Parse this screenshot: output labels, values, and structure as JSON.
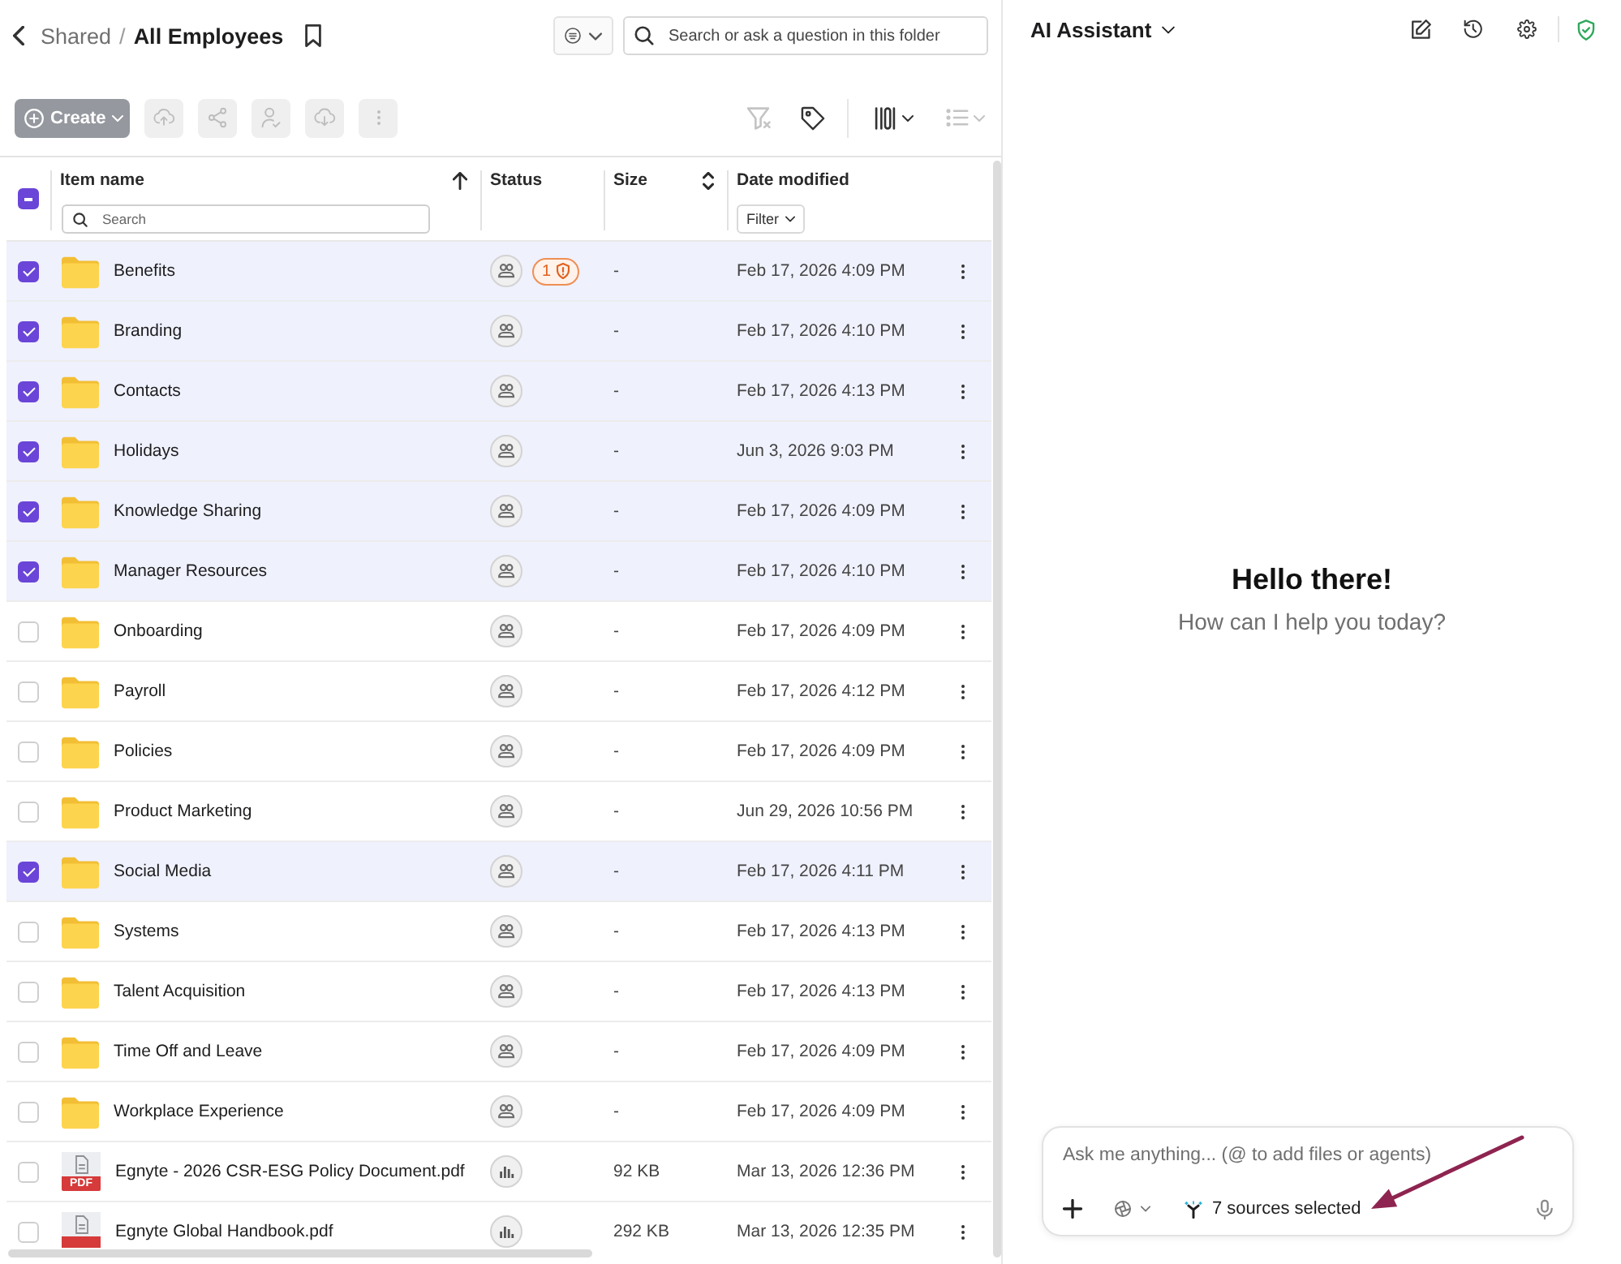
{
  "breadcrumb": {
    "items": [
      {
        "label": "Shared",
        "current": false
      },
      {
        "label": "All Employees",
        "current": true
      }
    ],
    "separator": "/",
    "bookmarked": false
  },
  "search": {
    "placeholder": "Search or ask a question in this folder"
  },
  "toolbar": {
    "create": {
      "label": "Create",
      "disabled": true
    },
    "actions": [
      {
        "kind": "upload",
        "disabled": true
      },
      {
        "kind": "share",
        "disabled": true
      },
      {
        "kind": "assign",
        "disabled": true
      },
      {
        "kind": "download",
        "disabled": true
      },
      {
        "kind": "more",
        "disabled": true
      }
    ],
    "view_tools": [
      {
        "kind": "clear_filter",
        "disabled": true,
        "menu": false
      },
      {
        "kind": "tags",
        "disabled": false,
        "menu": false
      },
      {
        "kind": "columns",
        "disabled": false,
        "menu": true
      },
      {
        "kind": "list_view",
        "disabled": true,
        "menu": true
      }
    ]
  },
  "table": {
    "select_all": {
      "indeterminate": true
    },
    "columns": [
      {
        "label": "Item name",
        "sortable": true,
        "sort_ascending": true,
        "search_placeholder": "Search"
      },
      {
        "label": "Status"
      },
      {
        "label": "Size",
        "sortable": true
      },
      {
        "label": "Date modified",
        "filter": "Filter"
      }
    ],
    "rows": [
      {
        "name": "Benefits",
        "kind": "folder",
        "selected": true,
        "status": {
          "kind": "shared"
        },
        "badge": "1",
        "size": "-",
        "modified": "Feb 17, 2026 4:09 PM"
      },
      {
        "name": "Branding",
        "kind": "folder",
        "selected": true,
        "status": {
          "kind": "shared"
        },
        "size": "-",
        "modified": "Feb 17, 2026 4:10 PM"
      },
      {
        "name": "Contacts",
        "kind": "folder",
        "selected": true,
        "status": {
          "kind": "shared"
        },
        "size": "-",
        "modified": "Feb 17, 2026 4:13 PM"
      },
      {
        "name": "Holidays",
        "kind": "folder",
        "selected": true,
        "status": {
          "kind": "shared"
        },
        "size": "-",
        "modified": "Jun 3, 2026 9:03 PM"
      },
      {
        "name": "Knowledge Sharing",
        "kind": "folder",
        "selected": true,
        "status": {
          "kind": "shared"
        },
        "size": "-",
        "modified": "Feb 17, 2026 4:09 PM"
      },
      {
        "name": "Manager Resources",
        "kind": "folder",
        "selected": true,
        "status": {
          "kind": "shared"
        },
        "size": "-",
        "modified": "Feb 17, 2026 4:10 PM"
      },
      {
        "name": "Onboarding",
        "kind": "folder",
        "selected": false,
        "status": {
          "kind": "shared"
        },
        "size": "-",
        "modified": "Feb 17, 2026 4:09 PM"
      },
      {
        "name": "Payroll",
        "kind": "folder",
        "selected": false,
        "status": {
          "kind": "shared"
        },
        "size": "-",
        "modified": "Feb 17, 2026 4:12 PM"
      },
      {
        "name": "Policies",
        "kind": "folder",
        "selected": false,
        "status": {
          "kind": "shared"
        },
        "size": "-",
        "modified": "Feb 17, 2026 4:09 PM"
      },
      {
        "name": "Product Marketing",
        "kind": "folder",
        "selected": false,
        "status": {
          "kind": "shared"
        },
        "size": "-",
        "modified": "Jun 29, 2026 10:56 PM"
      },
      {
        "name": "Social Media",
        "kind": "folder",
        "selected": true,
        "status": {
          "kind": "shared"
        },
        "size": "-",
        "modified": "Feb 17, 2026 4:11 PM"
      },
      {
        "name": "Systems",
        "kind": "folder",
        "selected": false,
        "status": {
          "kind": "shared"
        },
        "size": "-",
        "modified": "Feb 17, 2026 4:13 PM"
      },
      {
        "name": "Talent Acquisition",
        "kind": "folder",
        "selected": false,
        "status": {
          "kind": "shared"
        },
        "size": "-",
        "modified": "Feb 17, 2026 4:13 PM"
      },
      {
        "name": "Time Off and Leave",
        "kind": "folder",
        "selected": false,
        "status": {
          "kind": "shared"
        },
        "size": "-",
        "modified": "Feb 17, 2026 4:09 PM"
      },
      {
        "name": "Workplace Experience",
        "kind": "folder",
        "selected": false,
        "status": {
          "kind": "shared"
        },
        "size": "-",
        "modified": "Feb 17, 2026 4:09 PM"
      },
      {
        "name": "Egnyte - 2026 CSR-ESG Policy Document.pdf",
        "kind": "pdf",
        "type_label": "PDF",
        "selected": false,
        "status": {
          "kind": "analytics"
        },
        "size": "92 KB",
        "modified": "Mar 13, 2026 12:36 PM"
      },
      {
        "name": "Egnyte Global Handbook.pdf",
        "kind": "pdf",
        "selected": false,
        "status": {
          "kind": "analytics"
        },
        "size": "292 KB",
        "modified": "Mar 13, 2026 12:35 PM"
      }
    ]
  },
  "assistant": {
    "title": "AI Assistant",
    "tools": [
      {
        "kind": "new_chat"
      },
      {
        "kind": "history"
      },
      {
        "kind": "settings"
      },
      {
        "kind": "security"
      }
    ],
    "greeting": {
      "title": "Hello there!",
      "subtitle": "How can I help you today?"
    },
    "composer": {
      "placeholder": "Ask me anything... (@ to add files or agents)",
      "sources": "7 sources selected"
    }
  },
  "annotations": [
    {
      "kind": "arrow"
    }
  ]
}
